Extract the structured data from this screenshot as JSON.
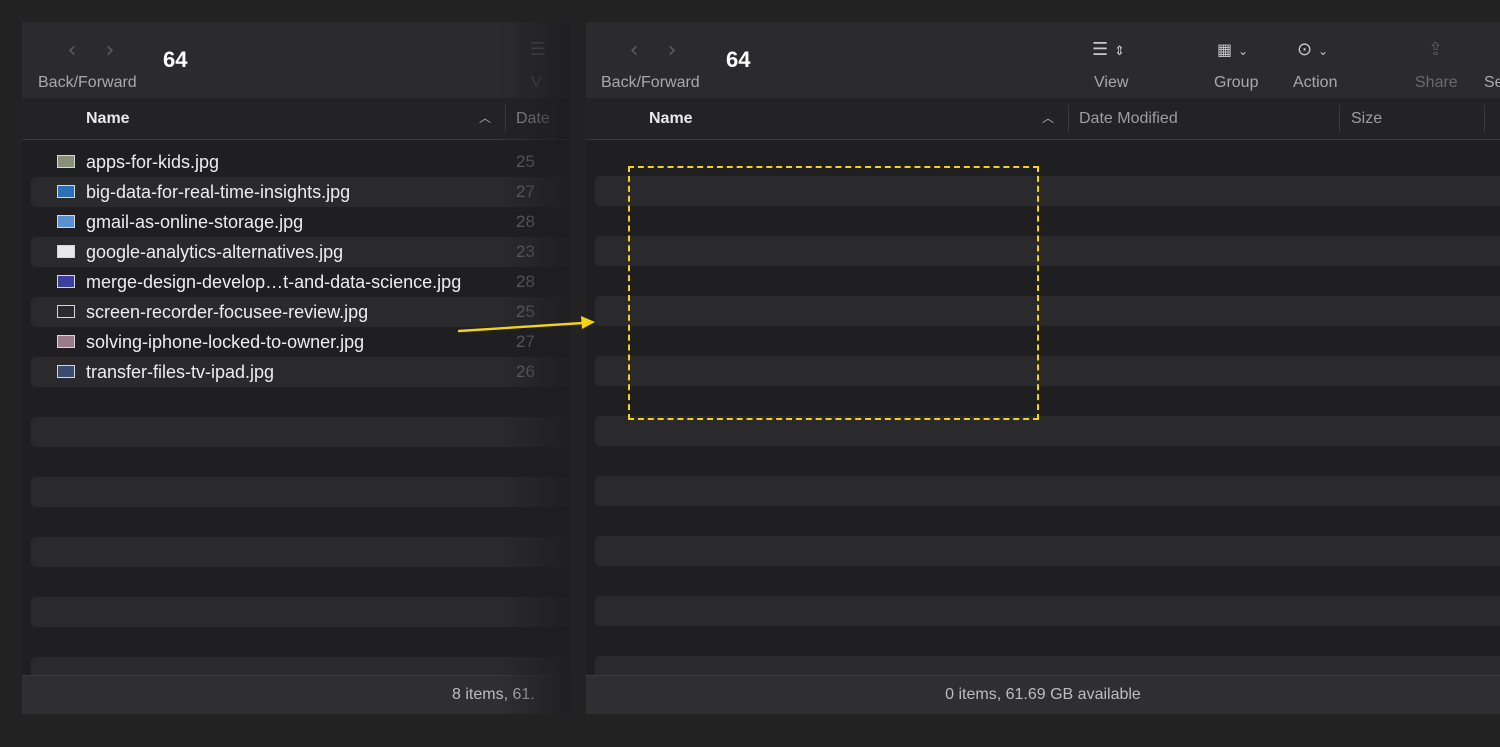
{
  "left_window": {
    "title": "64",
    "nav_label": "Back/Forward",
    "partial_toolbar_label": "V",
    "columns": {
      "name": "Name",
      "date_partial": "Date"
    },
    "files": [
      {
        "name": "apps-for-kids.jpg",
        "date_partial": "25",
        "thumb_color": "#8a8f7a"
      },
      {
        "name": "big-data-for-real-time-insights.jpg",
        "date_partial": "27",
        "thumb_color": "#2d6fb5"
      },
      {
        "name": "gmail-as-online-storage.jpg",
        "date_partial": "28",
        "thumb_color": "#5a8fd0"
      },
      {
        "name": "google-analytics-alternatives.jpg",
        "date_partial": "23",
        "thumb_color": "#e8e8e8"
      },
      {
        "name": "merge-design-develop…t-and-data-science.jpg",
        "date_partial": "28",
        "thumb_color": "#3b3f9e"
      },
      {
        "name": "screen-recorder-focusee-review.jpg",
        "date_partial": "25",
        "thumb_color": "#2b2b2b"
      },
      {
        "name": "solving-iphone-locked-to-owner.jpg",
        "date_partial": "27",
        "thumb_color": "#9b7b86"
      },
      {
        "name": "transfer-files-tv-ipad.jpg",
        "date_partial": "26",
        "thumb_color": "#3a4a70"
      }
    ],
    "status": "8 items, 61."
  },
  "right_window": {
    "title": "64",
    "nav_label": "Back/Forward",
    "toolbar": {
      "view_label": "View",
      "group_label": "Group",
      "action_label": "Action",
      "share_label": "Share",
      "search_label_partial": "Se"
    },
    "columns": {
      "name": "Name",
      "date_modified": "Date Modified",
      "size": "Size"
    },
    "status": "0 items, 61.69 GB available"
  },
  "icons": {
    "back": "chevron-left-icon",
    "forward": "chevron-right-icon",
    "view": "list-view-icon",
    "group": "group-grid-icon",
    "action": "ellipsis-circle-icon",
    "share": "share-icon",
    "sort": "sort-ascending-icon"
  },
  "colors": {
    "highlight": "#f3d21a",
    "window_bg": "#1f1f21"
  }
}
